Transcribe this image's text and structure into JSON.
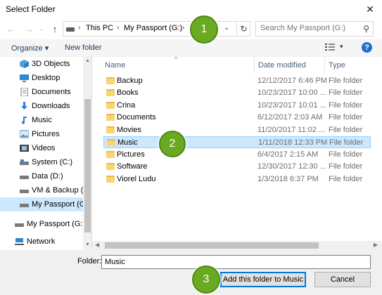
{
  "window": {
    "title": "Select Folder",
    "close_glyph": "✕"
  },
  "nav": {
    "back_glyph": "←",
    "forward_glyph": "→",
    "up_glyph": "↑",
    "refresh_glyph": "↻",
    "dropdown_glyph": "⌄",
    "breadcrumb": [
      "This PC",
      "My Passport (G:)"
    ],
    "separator": "›",
    "search_placeholder": "Search My Passport (G:)"
  },
  "toolbar": {
    "organize": "Organize ▾",
    "new_folder": "New folder",
    "view_dropdown": "▾",
    "help": "?"
  },
  "navpane": {
    "items": [
      {
        "label": "3D Objects",
        "icon": "3d-objects-icon"
      },
      {
        "label": "Desktop",
        "icon": "desktop-icon"
      },
      {
        "label": "Documents",
        "icon": "documents-icon"
      },
      {
        "label": "Downloads",
        "icon": "downloads-icon"
      },
      {
        "label": "Music",
        "icon": "music-icon"
      },
      {
        "label": "Pictures",
        "icon": "pictures-icon"
      },
      {
        "label": "Videos",
        "icon": "videos-icon"
      },
      {
        "label": "System (C:)",
        "icon": "drive-icon"
      },
      {
        "label": "Data (D:)",
        "icon": "drive-icon"
      },
      {
        "label": "VM & Backup (E",
        "icon": "drive-icon"
      },
      {
        "label": "My Passport (G:)",
        "icon": "drive-icon",
        "selected": true
      },
      {
        "label": "My Passport (G:)",
        "icon": "drive-icon"
      },
      {
        "label": "Network",
        "icon": "network-icon"
      }
    ]
  },
  "columns": {
    "name": "Name",
    "date": "Date modified",
    "type": "Type"
  },
  "files": [
    {
      "name": "Backup",
      "date": "12/12/2017 6:46 PM",
      "type": "File folder"
    },
    {
      "name": "Books",
      "date": "10/23/2017 10:00 ...",
      "type": "File folder"
    },
    {
      "name": "Crina",
      "date": "10/23/2017 10:01 ...",
      "type": "File folder"
    },
    {
      "name": "Documents",
      "date": "6/12/2017 2:03 AM",
      "type": "File folder"
    },
    {
      "name": "Movies",
      "date": "11/20/2017 11:02 ...",
      "type": "File folder"
    },
    {
      "name": "Music",
      "date": "1/11/2018 12:33 PM",
      "type": "File folder",
      "selected": true
    },
    {
      "name": "Pictures",
      "date": "6/4/2017 2:15 AM",
      "type": "File folder"
    },
    {
      "name": "Software",
      "date": "12/30/2017 12:30 ...",
      "type": "File folder"
    },
    {
      "name": "Viorel Ludu",
      "date": "1/3/2018 6:37 PM",
      "type": "File folder"
    }
  ],
  "footer": {
    "folder_label": "Folder:",
    "folder_value": "Music",
    "primary_button": "Add this folder to Music",
    "cancel_button": "Cancel"
  },
  "badges": [
    "1",
    "2",
    "3"
  ],
  "colors": {
    "selection": "#cce8ff",
    "selection_border": "#99d1ff",
    "accent": "#0078d7",
    "badge": "#6aaa22",
    "folder": "#f8d574"
  }
}
